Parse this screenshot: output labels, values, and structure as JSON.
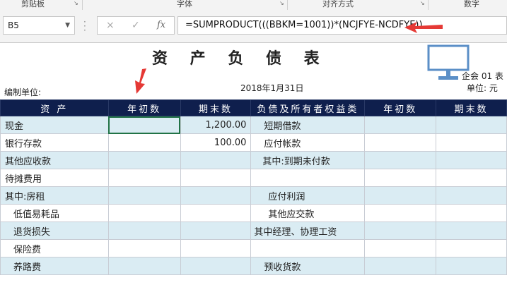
{
  "ribbon": {
    "groups": [
      "剪贴板",
      "字体",
      "对齐方式",
      "数字"
    ]
  },
  "formula_bar": {
    "name_box": "B5",
    "cancel_icon": "×",
    "enter_icon": "✓",
    "fx_label": "fx",
    "formula": "=SUMPRODUCT(((BBKM=1001))*(NCJFYE-NCDFYE))"
  },
  "sheet": {
    "title": "资 产 负 债 表",
    "date": "2018年1月31日",
    "unit_label": "编制单位:",
    "corp_label": "企会 01 表",
    "currency_label": "单位:  元",
    "headers": [
      "资    产",
      "年初数",
      "期末数",
      "负债及所有者权益类",
      "年初数",
      "期末数"
    ],
    "rows": [
      {
        "asset": "现金",
        "begin": "",
        "end": "1,200.00",
        "liab": "短期借款",
        "lbegin": "",
        "lend": ""
      },
      {
        "asset": "银行存款",
        "begin": "",
        "end": "100.00",
        "liab": "应付帐款",
        "lbegin": "",
        "lend": ""
      },
      {
        "asset": "其他应收款",
        "begin": "",
        "end": "",
        "liab": "其中:到期未付款",
        "lbegin": "",
        "lend": ""
      },
      {
        "asset": "待摊费用",
        "begin": "",
        "end": "",
        "liab": "",
        "lbegin": "",
        "lend": ""
      },
      {
        "asset": "其中:房租",
        "begin": "",
        "end": "",
        "liab": "应付利润",
        "lbegin": "",
        "lend": ""
      },
      {
        "asset": "低值易耗品",
        "begin": "",
        "end": "",
        "liab": "其他应交款",
        "lbegin": "",
        "lend": ""
      },
      {
        "asset": "退货损失",
        "begin": "",
        "end": "",
        "liab": "其中经理、协理工资",
        "lbegin": "",
        "lend": ""
      },
      {
        "asset": "保险费",
        "begin": "",
        "end": "",
        "liab": "",
        "lbegin": "",
        "lend": ""
      },
      {
        "asset": "养路费",
        "begin": "",
        "end": "",
        "liab": "预收货款",
        "lbegin": "",
        "lend": ""
      }
    ]
  },
  "colors": {
    "header_bg": "#0f1f4d",
    "band_bg": "#daecf3",
    "selection": "#217346",
    "arrow": "#e53935",
    "monitor": "#5b8fc7"
  }
}
